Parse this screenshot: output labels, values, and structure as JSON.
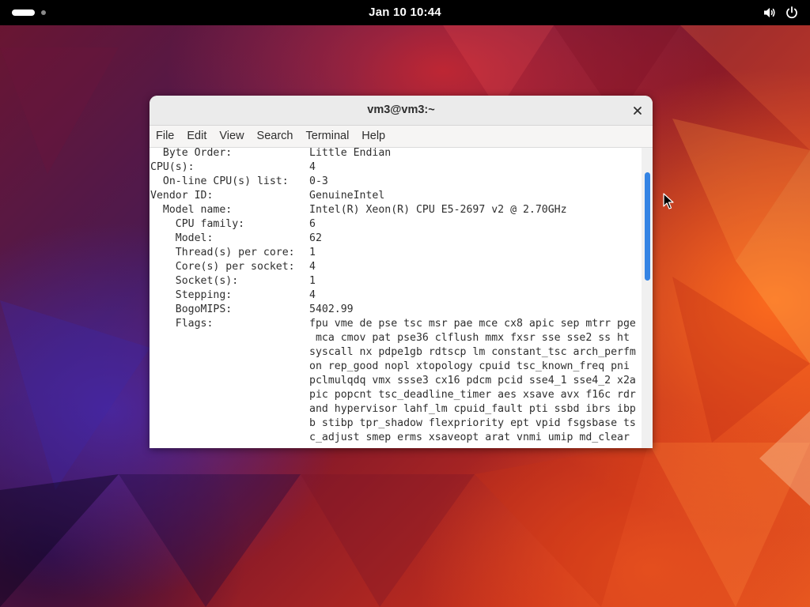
{
  "topbar": {
    "clock": "Jan 10  10:44",
    "tray_icons": [
      "volume-icon",
      "power-icon"
    ]
  },
  "window": {
    "title": "vm3@vm3:~",
    "menu": [
      "File",
      "Edit",
      "View",
      "Search",
      "Terminal",
      "Help"
    ],
    "terminal_lines": [
      {
        "label": "  Byte Order:",
        "value": "Little Endian"
      },
      {
        "label": "CPU(s):",
        "value": "4"
      },
      {
        "label": "  On-line CPU(s) list:",
        "value": "0-3"
      },
      {
        "label": "Vendor ID:",
        "value": "GenuineIntel"
      },
      {
        "label": "  Model name:",
        "value": "Intel(R) Xeon(R) CPU E5-2697 v2 @ 2.70GHz"
      },
      {
        "label": "    CPU family:",
        "value": "6"
      },
      {
        "label": "    Model:",
        "value": "62"
      },
      {
        "label": "    Thread(s) per core:",
        "value": "1"
      },
      {
        "label": "    Core(s) per socket:",
        "value": "4"
      },
      {
        "label": "    Socket(s):",
        "value": "1"
      },
      {
        "label": "    Stepping:",
        "value": "4"
      },
      {
        "label": "    BogoMIPS:",
        "value": "5402.99"
      },
      {
        "label": "    Flags:",
        "value": "fpu vme de pse tsc msr pae mce cx8 apic sep mtrr pge"
      },
      {
        "label": "",
        "value": " mca cmov pat pse36 clflush mmx fxsr sse sse2 ss ht"
      },
      {
        "label": "",
        "value": "syscall nx pdpe1gb rdtscp lm constant_tsc arch_perfm"
      },
      {
        "label": "",
        "value": "on rep_good nopl xtopology cpuid tsc_known_freq pni"
      },
      {
        "label": "",
        "value": "pclmulqdq vmx ssse3 cx16 pdcm pcid sse4_1 sse4_2 x2a"
      },
      {
        "label": "",
        "value": "pic popcnt tsc_deadline_timer aes xsave avx f16c rdr"
      },
      {
        "label": "",
        "value": "and hypervisor lahf_lm cpuid_fault pti ssbd ibrs ibp"
      },
      {
        "label": "",
        "value": "b stibp tpr_shadow flexpriority ept vpid fsgsbase ts"
      },
      {
        "label": "",
        "value": "c_adjust smep erms xsaveopt arat vnmi umip md_clear"
      }
    ],
    "scroll_position": 0.1
  },
  "colors": {
    "accent": "#3584e4",
    "topbar": "#000000",
    "terminal_text": "#2e2e2e"
  }
}
